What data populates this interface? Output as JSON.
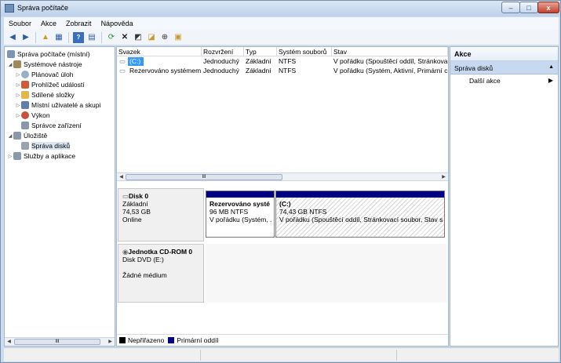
{
  "window": {
    "title": "Správa počítače"
  },
  "window_controls": {
    "minimize": "–",
    "maximize": "□",
    "close": "x"
  },
  "menu": [
    "Soubor",
    "Akce",
    "Zobrazit",
    "Nápověda"
  ],
  "toolbar": [
    "back-icon",
    "forward-icon",
    "up-folder-icon",
    "show-hide-tree-icon",
    "help-icon",
    "properties-icon",
    "refresh-icon",
    "delete-icon",
    "new-icon",
    "open-icon",
    "zoom-icon",
    "settings-icon"
  ],
  "tree": {
    "root": "Správa počítače (místní)",
    "items": [
      {
        "label": "Systémové nástroje",
        "icon": "tools-icon"
      },
      {
        "label": "Plánovač úloh",
        "icon": "clock-icon"
      },
      {
        "label": "Prohlížeč událostí",
        "icon": "event-icon"
      },
      {
        "label": "Sdílené složky",
        "icon": "folder-icon"
      },
      {
        "label": "Místní uživatelé a skupi",
        "icon": "users-icon"
      },
      {
        "label": "Výkon",
        "icon": "performance-icon"
      },
      {
        "label": "Správce zařízení",
        "icon": "device-icon"
      },
      {
        "label": "Úložiště",
        "icon": "storage-icon"
      },
      {
        "label": "Správa disků",
        "icon": "disk-icon"
      },
      {
        "label": "Služby a aplikace",
        "icon": "services-icon"
      }
    ]
  },
  "volumes": {
    "columns": [
      "Svazek",
      "Rozvržení",
      "Typ",
      "Systém souborů",
      "Stav"
    ],
    "rows": [
      [
        "(C:)",
        "Jednoduchý",
        "Základní",
        "NTFS",
        "V pořádku (Spouštěcí oddíl, Stránkova"
      ],
      [
        "Rezervováno systémem",
        "Jednoduchý",
        "Základní",
        "NTFS",
        "V pořádku (Systém, Aktivní, Primární c"
      ]
    ]
  },
  "scroll_grip": "III",
  "disks": {
    "disk0": {
      "name": "Disk 0",
      "type": "Základní",
      "size": "74,53 GB",
      "status": "Online",
      "partitions": [
        {
          "name": "Rezervováno systé",
          "size": "96 MB NTFS",
          "status": "V pořádku (Systém, ."
        },
        {
          "name": "(C:)",
          "size": "74,43 GB NTFS",
          "status": "V pořádku (Spouštěcí oddíl, Stránkovací soubor, Stav s"
        }
      ]
    },
    "cdrom": {
      "name": "Jednotka CD-ROM 0",
      "type": "Disk DVD (E:)",
      "status": "Žádné médium"
    }
  },
  "legend": [
    {
      "label": "Nepřiřazeno",
      "color": "#000000"
    },
    {
      "label": "Primární oddíl",
      "color": "#000080"
    }
  ],
  "actions": {
    "header": "Akce",
    "section": "Správa disků",
    "more": "Další akce"
  }
}
